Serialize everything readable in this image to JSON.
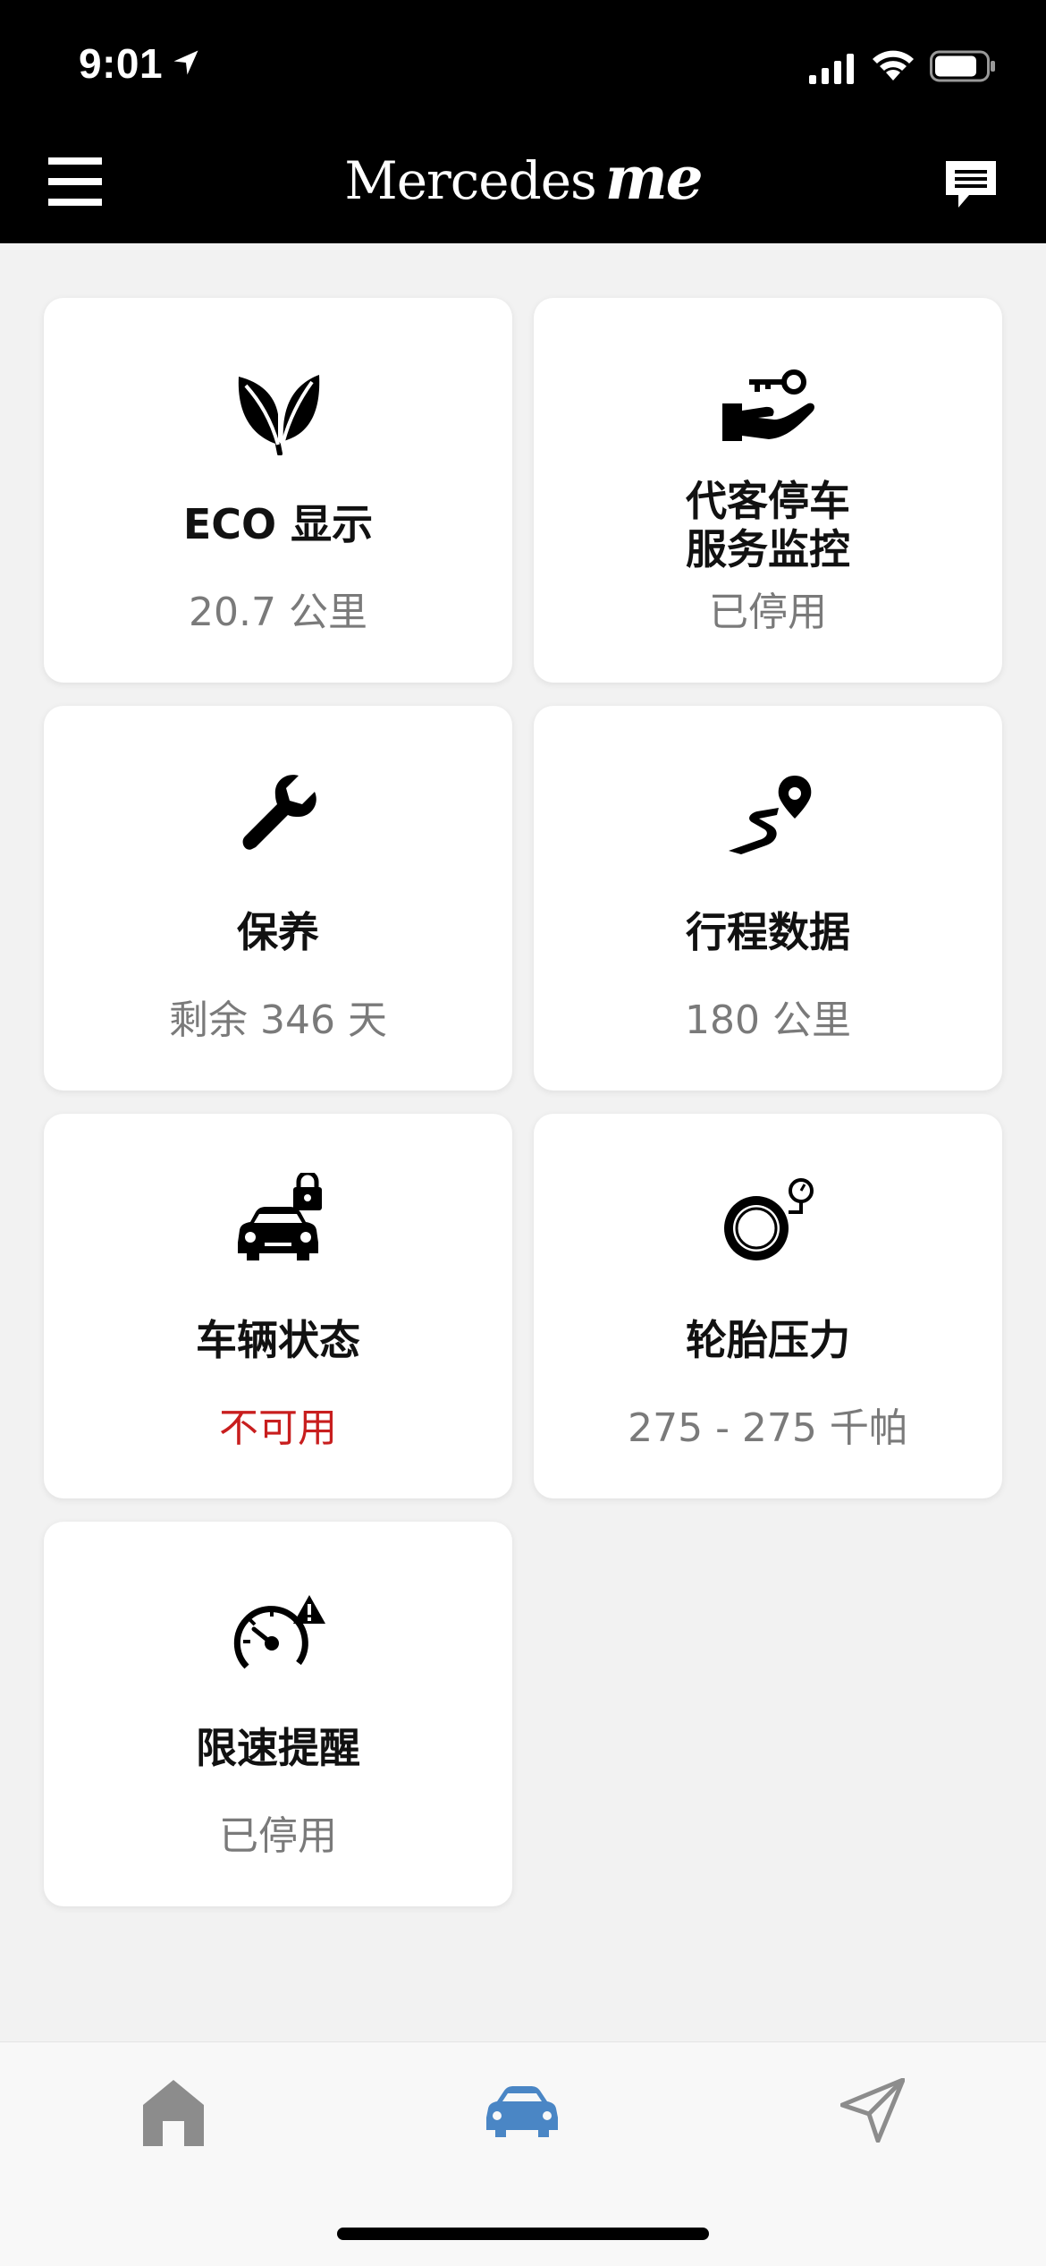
{
  "status_bar": {
    "time": "9:01"
  },
  "header": {
    "brand_word": "Mercedes",
    "brand_me": "me"
  },
  "cards": [
    {
      "title": "ECO 显示",
      "value": "20.7 公里",
      "icon": "leaf-icon"
    },
    {
      "title_line1": "代客停车",
      "title_line2": "服务监控",
      "value": "已停用",
      "icon": "valet-key-icon"
    },
    {
      "title": "保养",
      "value": "剩余 346 天",
      "icon": "wrench-icon"
    },
    {
      "title": "行程数据",
      "value": "180 公里",
      "icon": "route-pin-icon"
    },
    {
      "title": "车辆状态",
      "value": "不可用",
      "icon": "car-lock-icon"
    },
    {
      "title": "轮胎压力",
      "value": "275 - 275 千帕",
      "icon": "tire-gauge-icon"
    },
    {
      "title": "限速提醒",
      "value": "已停用",
      "icon": "speedometer-warning-icon"
    }
  ],
  "colors": {
    "unavailable": "#c81e1e",
    "active_tab": "#4a86c5",
    "inactive_tab": "#8c8c8c"
  },
  "tabs": [
    {
      "icon": "home-icon",
      "active": false
    },
    {
      "icon": "car-icon",
      "active": true
    },
    {
      "icon": "navigation-icon",
      "active": false
    }
  ]
}
